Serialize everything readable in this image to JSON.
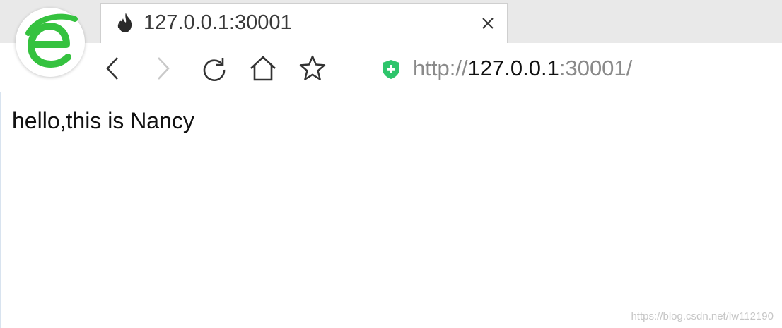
{
  "browser": {
    "logo_icon": "browser-e-logo-icon",
    "accent_green": "#35c23f",
    "tab": {
      "title": "127.0.0.1:30001",
      "favicon": "flame-icon",
      "close_icon": "close-icon"
    },
    "toolbar": {
      "back_icon": "chevron-left-icon",
      "forward_icon": "chevron-right-icon",
      "reload_icon": "reload-icon",
      "home_icon": "home-icon",
      "bookmark_icon": "star-icon"
    },
    "address": {
      "security_icon": "shield-plus-icon",
      "security_color": "#2ec56b",
      "scheme": "http://",
      "host": "127.0.0.1",
      "port_path": ":30001/"
    }
  },
  "page": {
    "text": "hello,this is Nancy"
  },
  "watermark": "https://blog.csdn.net/lw112190"
}
